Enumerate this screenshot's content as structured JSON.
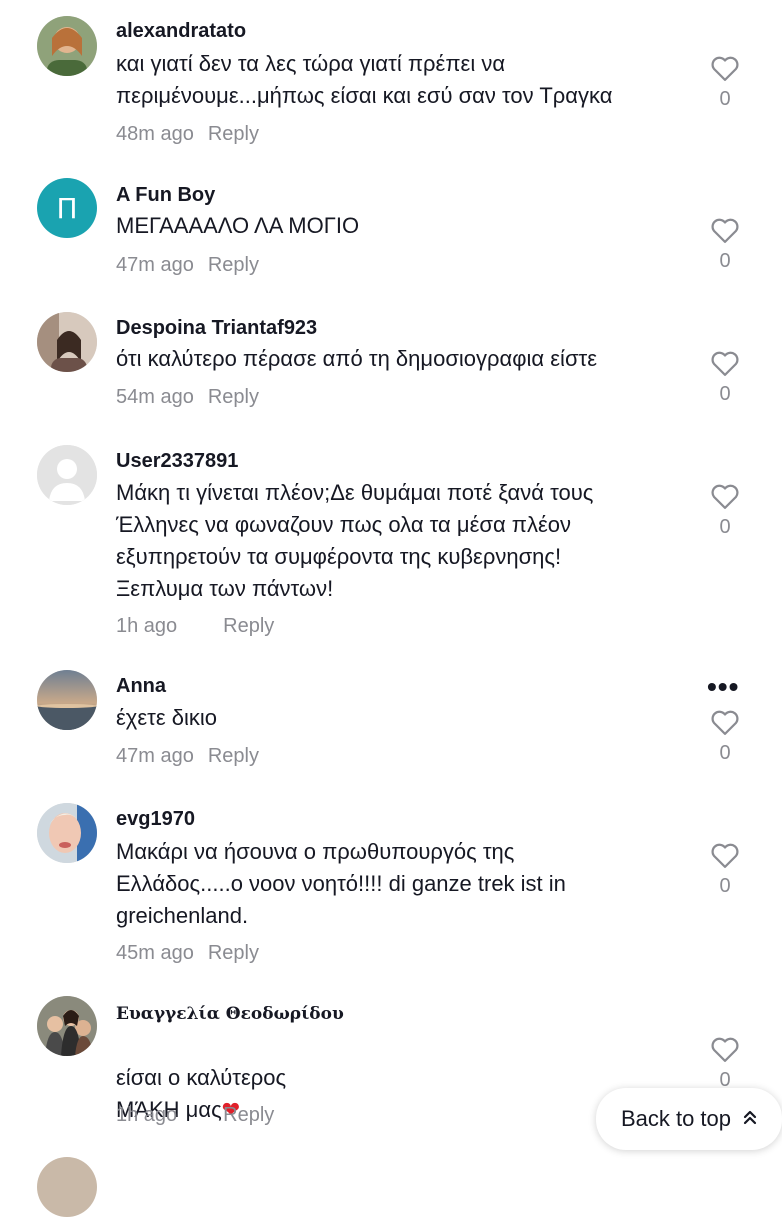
{
  "comments": [
    {
      "username": "alexandratato",
      "text": "και γιατί δεν τα λες τώρα γιατί πρέπει να\nπεριμένουμε...μήπως είσαι και εσύ σαν τον Τραγκα",
      "time": "48m ago",
      "reply": "Reply",
      "likes": "0"
    },
    {
      "username": "A Fun Boy",
      "avatar_letter": "Π",
      "text": "ΜΕΓΑΑΑΑΛΟ ΛΑ ΜΟΓΙΟ",
      "time": "47m ago",
      "reply": "Reply",
      "likes": "0",
      "avatar_color": "#1aa3b0"
    },
    {
      "username": "Despoina Triantaf923",
      "text": "ότι καλύτερο πέρασε από τη δημοσιογραφια είστε",
      "time": "54m ago",
      "reply": "Reply",
      "likes": "0"
    },
    {
      "username": "User2337891",
      "text": "Μάκη τι γίνεται πλέον;Δε θυμάμαι ποτέ ξανά τους\nΈλληνες να φωναζουν πως ολα τα μέσα πλέον\nεξυπηρετούν τα συμφέροντα της κυβερνησης!\nΞεπλυμα των πάντων!",
      "time": "1h ago",
      "reply": "Reply",
      "likes": "0"
    },
    {
      "username": "Anna",
      "text": "έχετε δικιο",
      "time": "47m ago",
      "reply": "Reply",
      "likes": "0",
      "more": "•••"
    },
    {
      "username": "evg1970",
      "text": "Μακάρι να ήσουνα ο πρωθυπουργός της\nΕλλάδος.....ο νοον νοητό!!!! di ganze trek ist in\ngreichenland.",
      "time": "45m ago",
      "reply": "Reply",
      "likes": "0"
    },
    {
      "username": "Ευαγγελία Θεοδωρίδου",
      "text": "είσαι ο καλύτερος\nΜΆΚΗ μας",
      "emoji": "❤",
      "time": "1h ago",
      "reply": "Reply",
      "likes": "0"
    }
  ],
  "back_to_top": {
    "label": "Back to top",
    "icon": "double-chevron-up-icon"
  },
  "colors": {
    "muted": "#8a8b91",
    "text": "#161823",
    "heart": "#e0202a"
  }
}
